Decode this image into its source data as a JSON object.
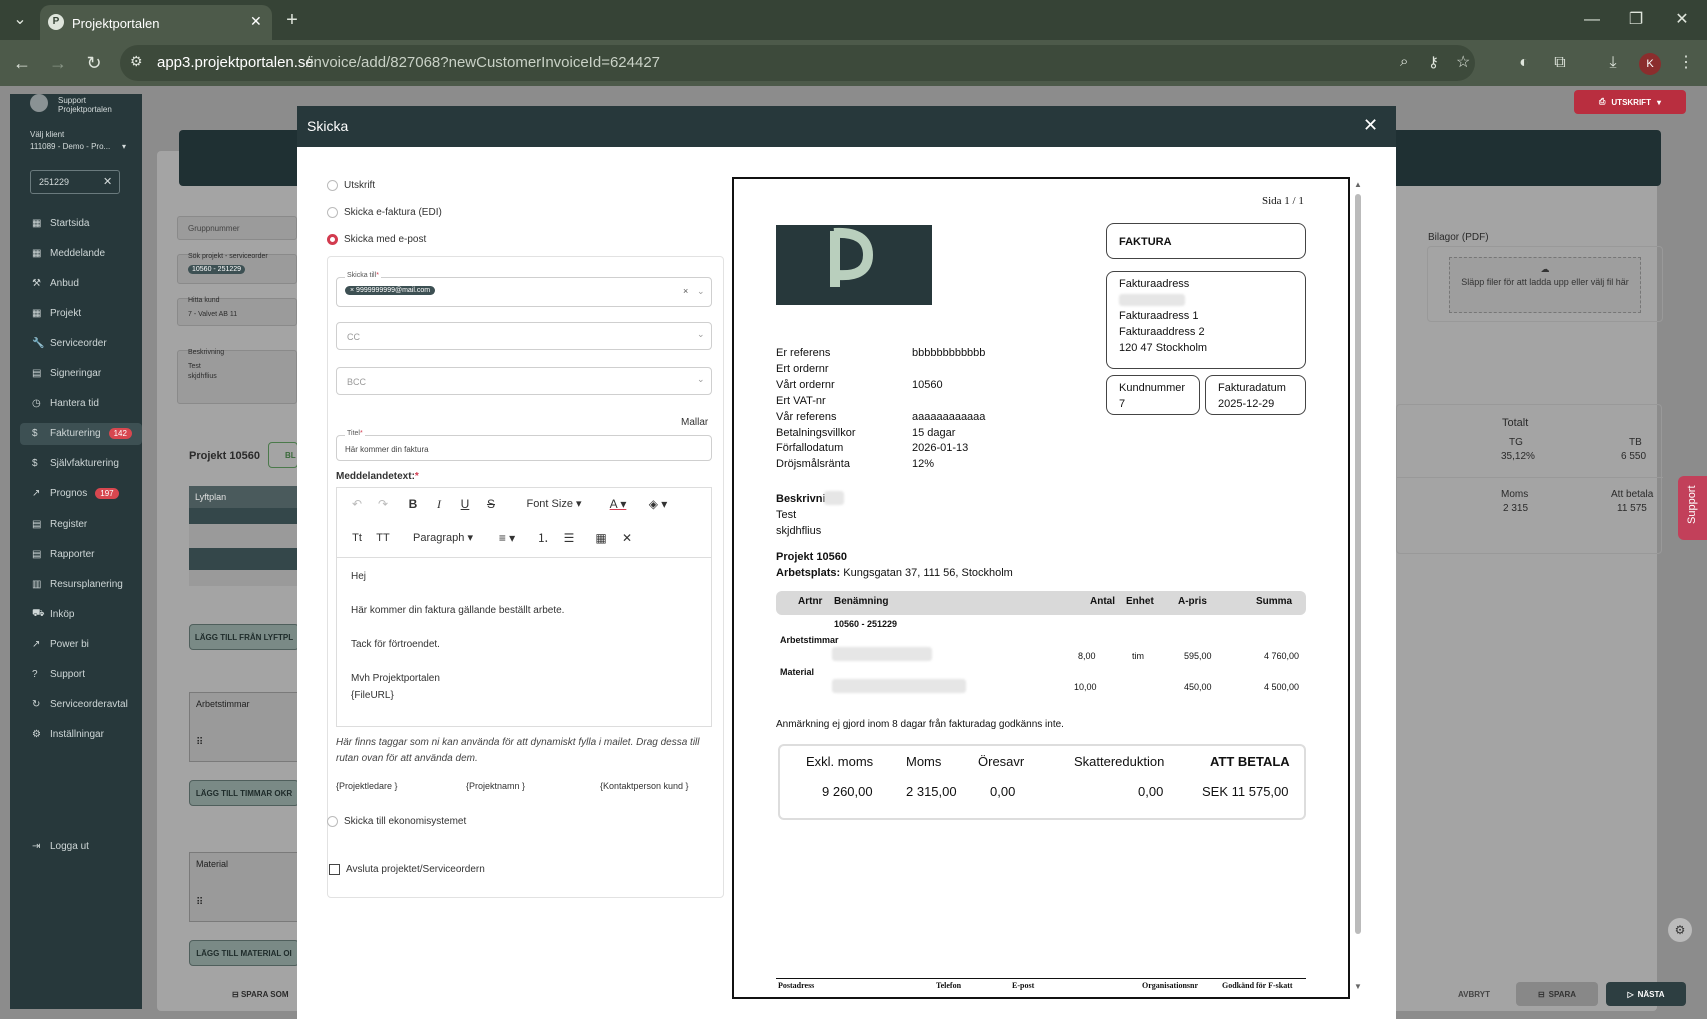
{
  "browser": {
    "tab_title": "Projektportalen",
    "url_host": "app3.projektportalen.se",
    "url_path": "/invoice/add/827068?newCustomerInvoiceId=624427",
    "profile_initial": "K"
  },
  "sidebar": {
    "support_user": "Support Projektportalen",
    "client_label": "Välj klient",
    "client_value": "111089 - Demo - Pro...",
    "search_value": "251229",
    "items": [
      {
        "label": "Startsida",
        "icon": "grid-icon"
      },
      {
        "label": "Meddelande",
        "icon": "grid-icon"
      },
      {
        "label": "Anbud",
        "icon": "hammer-icon"
      },
      {
        "label": "Projekt",
        "icon": "grid-icon"
      },
      {
        "label": "Serviceorder",
        "icon": "wrench-icon"
      },
      {
        "label": "Signeringar",
        "icon": "doc-icon"
      },
      {
        "label": "Hantera tid",
        "icon": "clock-icon"
      },
      {
        "label": "Fakturering",
        "icon": "dollar-icon",
        "badge": "142"
      },
      {
        "label": "Självfakturering",
        "icon": "dollar-icon"
      },
      {
        "label": "Prognos",
        "icon": "chart-icon",
        "badge": "197"
      },
      {
        "label": "Register",
        "icon": "doc-icon"
      },
      {
        "label": "Rapporter",
        "icon": "doc-icon"
      },
      {
        "label": "Resursplanering",
        "icon": "calendar-icon"
      },
      {
        "label": "Inköp",
        "icon": "cart-icon"
      },
      {
        "label": "Power bi",
        "icon": "chart-icon"
      },
      {
        "label": "Support",
        "icon": "help-icon"
      },
      {
        "label": "Serviceorderavtal",
        "icon": "refresh-icon"
      },
      {
        "label": "Inställningar",
        "icon": "gear-icon"
      },
      {
        "label": "Logga ut",
        "icon": "logout-icon"
      }
    ]
  },
  "background": {
    "print_button": "UTSKRIFT",
    "gruppnummer": "Gruppnummer",
    "sok_label": "Sök projekt - serviceorder",
    "sok_tag": "10560 - 251229",
    "hitta_label": "Hitta kund",
    "hitta_value": "7 - Valvet AB 11",
    "beskrivning_label": "Beskrivning",
    "beskrivning_lines": [
      "Test",
      "skjdhflius"
    ],
    "projekt": "Projekt 10560",
    "bl_btn": "BL",
    "lyftplan": "Lyftplan",
    "lagg_lyft": "LÄGG TILL FRÅN LYFTPL",
    "arbetstimmar": "Arbetstimmar",
    "lagg_timmar": "LÄGG TILL TIMMAR OKR",
    "material": "Material",
    "lagg_material": "LÄGG TILL MATERIAL OI",
    "spara_som": "SPARA SOM",
    "bilagor": "Bilagor (PDF)",
    "drop_text": "Släpp filer för att ladda upp eller välj fil här",
    "totalt": "Totalt",
    "tg_label": "TG",
    "tg_value": "35,12%",
    "tb_label": "TB",
    "tb_value": "6 550",
    "moms_label": "Moms",
    "moms_value": "2 315",
    "att_label": "Att betala",
    "att_value": "11 575",
    "avbryt": "AVBRYT",
    "spara": "SPARA",
    "nasta": "NÄSTA",
    "support_tab": "Support"
  },
  "modal": {
    "title": "Skicka",
    "options": [
      "Utskrift",
      "Skicka e-faktura (EDI)",
      "Skicka med e-post"
    ],
    "to_label": "Skicka till",
    "to_tag": "9999999999@mail.com",
    "cc": "CC",
    "bcc": "BCC",
    "mallar": "Mallar",
    "titel_label": "Titel",
    "titel_value": "Här kommer din faktura",
    "meddelande_label": "Meddelandetext:",
    "font_size": "Font Size",
    "paragraph": "Paragraph",
    "body_lines": [
      "Hej",
      "",
      "Här kommer din faktura gällande beställt arbete.",
      "",
      "Tack för förtroendet.",
      "",
      "Mvh Projektportalen",
      "{FileURL}"
    ],
    "hint": "Här finns taggar som ni kan använda för att dynamiskt fylla i mailet. Drag dessa till rutan ovan för att använda dem.",
    "tags": [
      "{Projektledare }",
      "{Projektnamn }",
      "{Kontaktperson kund }"
    ],
    "ekonomi": "Skicka till ekonomisystemet",
    "avsluta": "Avsluta projektet/Serviceordern"
  },
  "invoice": {
    "page": "Sida 1 / 1",
    "faktura": "FAKTURA",
    "addr_label": "Fakturaadress",
    "addr_lines": [
      "Fakturaadress 1",
      "Fakturaaddress 2",
      "120 47 Stockholm"
    ],
    "kundnr_label": "Kundnummer",
    "kundnr": "7",
    "datum_label": "Fakturadatum",
    "datum": "2025-12-29",
    "meta": [
      [
        "Er referens",
        "bbbbbbbbbbbb"
      ],
      [
        "Ert ordernr",
        ""
      ],
      [
        "Vårt ordernr",
        "10560"
      ],
      [
        "Ert VAT-nr",
        ""
      ],
      [
        "Vår referens",
        "aaaaaaaaaaaa"
      ],
      [
        "Betalningsvillkor",
        "15 dagar"
      ],
      [
        "Förfallodatum",
        "2026-01-13"
      ],
      [
        "Dröjsmålsränta",
        "12%"
      ]
    ],
    "beskr_label": "Beskrivni",
    "beskr_lines": [
      "Test",
      "skjdhflius"
    ],
    "projekt": "Projekt 10560",
    "arbetsplats_label": "Arbetsplats:",
    "arbetsplats": "Kungsgatan 37, 111 56, Stockholm",
    "cols": [
      "Artnr",
      "Benämning",
      "Antal",
      "Enhet",
      "A-pris",
      "Summa"
    ],
    "group": "10560 - 251229",
    "rows": [
      {
        "cat": "Arbetstimmar",
        "antal": "8,00",
        "enhet": "tim",
        "apris": "595,00",
        "summa": "4 760,00"
      },
      {
        "cat": "Material",
        "antal": "10,00",
        "enhet": "",
        "apris": "450,00",
        "summa": "4 500,00"
      }
    ],
    "note": "Anmärkning ej gjord inom 8 dagar från fakturadag godkänns inte.",
    "tot_heads": [
      "Exkl. moms",
      "Moms",
      "Öresavr",
      "Skattereduktion",
      "ATT BETALA"
    ],
    "tot_vals": [
      "9 260,00",
      "2 315,00",
      "0,00",
      "0,00",
      "SEK 11 575,00"
    ],
    "footer": [
      "Postadress",
      "Telefon",
      "E-post",
      "Organisationsnr",
      "Godkänd för F-skatt"
    ]
  }
}
